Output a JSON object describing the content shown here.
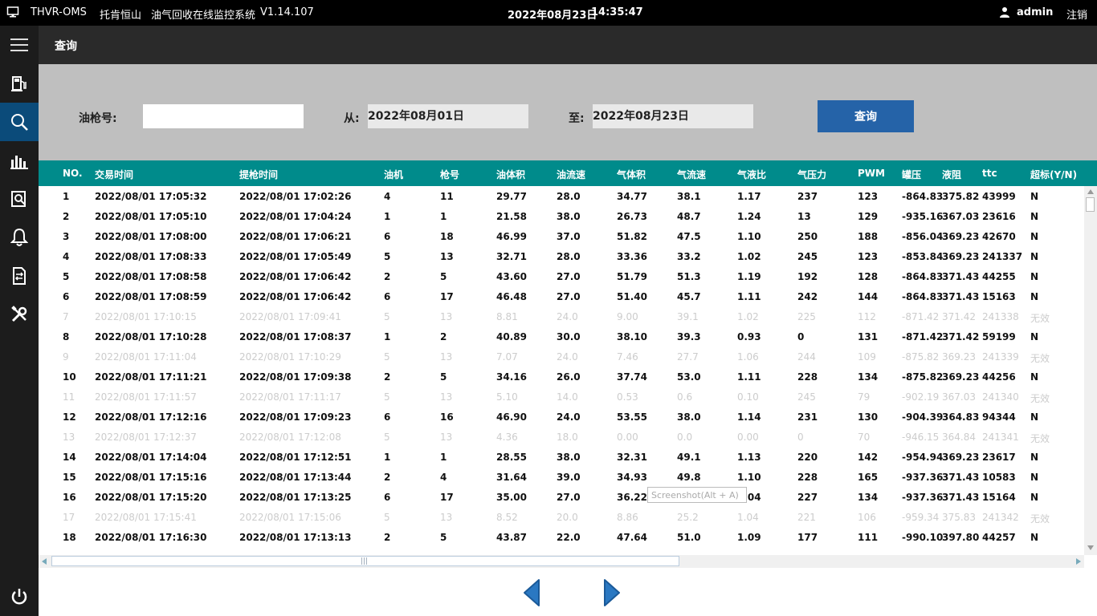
{
  "topbar": {
    "app_name": "THVR-OMS",
    "site": "托肯恒山",
    "system_name": "油气回收在线监控系统",
    "version": "V1.14.107",
    "date": "2022年08月23日",
    "time": "14:35:47",
    "user": "admin",
    "logout": "注销"
  },
  "page": {
    "title": "查询"
  },
  "filter": {
    "gun_label": "油枪号:",
    "gun_value": "",
    "from_label": "从:",
    "from_value": "2022年08月01日",
    "to_label": "至:",
    "to_value": "2022年08月23日",
    "query_button": "查询"
  },
  "table": {
    "headers": [
      "NO.",
      "交易时间",
      "提枪时间",
      "油机",
      "枪号",
      "油体积",
      "油流速",
      "气体积",
      "气流速",
      "气液比",
      "气压力",
      "PWM",
      "罐压",
      "液阻",
      "ttc",
      "超标(Y/N)"
    ],
    "rows": [
      [
        "1",
        "2022/08/01 17:05:32",
        "2022/08/01 17:02:26",
        "4",
        "11",
        "29.77",
        "28.0",
        "34.77",
        "38.1",
        "1.17",
        "237",
        "123",
        "-864.83",
        "375.82",
        "43999",
        "N"
      ],
      [
        "2",
        "2022/08/01 17:05:10",
        "2022/08/01 17:04:24",
        "1",
        "1",
        "21.58",
        "38.0",
        "26.73",
        "48.7",
        "1.24",
        "13",
        "129",
        "-935.16",
        "367.03",
        "23616",
        "N"
      ],
      [
        "3",
        "2022/08/01 17:08:00",
        "2022/08/01 17:06:21",
        "6",
        "18",
        "46.99",
        "37.0",
        "51.82",
        "47.5",
        "1.10",
        "250",
        "188",
        "-856.04",
        "369.23",
        "42670",
        "N"
      ],
      [
        "4",
        "2022/08/01 17:08:33",
        "2022/08/01 17:05:49",
        "5",
        "13",
        "32.71",
        "28.0",
        "33.36",
        "33.2",
        "1.02",
        "245",
        "123",
        "-853.84",
        "369.23",
        "241337",
        "N"
      ],
      [
        "5",
        "2022/08/01 17:08:58",
        "2022/08/01 17:06:42",
        "2",
        "5",
        "43.60",
        "27.0",
        "51.79",
        "51.3",
        "1.19",
        "192",
        "128",
        "-864.83",
        "371.43",
        "44255",
        "N"
      ],
      [
        "6",
        "2022/08/01 17:08:59",
        "2022/08/01 17:06:42",
        "6",
        "17",
        "46.48",
        "27.0",
        "51.40",
        "45.7",
        "1.11",
        "242",
        "144",
        "-864.83",
        "371.43",
        "15163",
        "N"
      ],
      [
        "7",
        "2022/08/01 17:10:15",
        "2022/08/01 17:09:41",
        "5",
        "13",
        "8.81",
        "24.0",
        "9.00",
        "39.1",
        "1.02",
        "225",
        "112",
        "-871.42",
        "371.42",
        "241338",
        "无效"
      ],
      [
        "8",
        "2022/08/01 17:10:28",
        "2022/08/01 17:08:37",
        "1",
        "2",
        "40.89",
        "30.0",
        "38.10",
        "39.3",
        "0.93",
        "0",
        "131",
        "-871.42",
        "371.42",
        "59199",
        "N"
      ],
      [
        "9",
        "2022/08/01 17:11:04",
        "2022/08/01 17:10:29",
        "5",
        "13",
        "7.07",
        "24.0",
        "7.46",
        "27.7",
        "1.06",
        "244",
        "109",
        "-875.82",
        "369.23",
        "241339",
        "无效"
      ],
      [
        "10",
        "2022/08/01 17:11:21",
        "2022/08/01 17:09:38",
        "2",
        "5",
        "34.16",
        "26.0",
        "37.74",
        "53.0",
        "1.11",
        "228",
        "134",
        "-875.82",
        "369.23",
        "44256",
        "N"
      ],
      [
        "11",
        "2022/08/01 17:11:57",
        "2022/08/01 17:11:17",
        "5",
        "13",
        "5.10",
        "14.0",
        "0.53",
        "0.6",
        "0.10",
        "245",
        "79",
        "-902.19",
        "367.03",
        "241340",
        "无效"
      ],
      [
        "12",
        "2022/08/01 17:12:16",
        "2022/08/01 17:09:23",
        "6",
        "16",
        "46.90",
        "24.0",
        "53.55",
        "38.0",
        "1.14",
        "231",
        "130",
        "-904.39",
        "364.83",
        "94344",
        "N"
      ],
      [
        "13",
        "2022/08/01 17:12:37",
        "2022/08/01 17:12:08",
        "5",
        "13",
        "4.36",
        "18.0",
        "0.00",
        "0.0",
        "0.00",
        "0",
        "70",
        "-946.15",
        "364.84",
        "241341",
        "无效"
      ],
      [
        "14",
        "2022/08/01 17:14:04",
        "2022/08/01 17:12:51",
        "1",
        "1",
        "28.55",
        "38.0",
        "32.31",
        "49.1",
        "1.13",
        "220",
        "142",
        "-954.94",
        "369.23",
        "23617",
        "N"
      ],
      [
        "15",
        "2022/08/01 17:15:16",
        "2022/08/01 17:13:44",
        "2",
        "4",
        "31.64",
        "39.0",
        "34.93",
        "49.8",
        "1.10",
        "228",
        "165",
        "-937.36",
        "371.43",
        "10583",
        "N"
      ],
      [
        "16",
        "2022/08/01 17:15:20",
        "2022/08/01 17:13:25",
        "6",
        "17",
        "35.00",
        "27.0",
        "36.22",
        "46.1",
        "1.04",
        "227",
        "134",
        "-937.36",
        "371.43",
        "15164",
        "N"
      ],
      [
        "17",
        "2022/08/01 17:15:41",
        "2022/08/01 17:15:06",
        "5",
        "13",
        "8.52",
        "20.0",
        "8.86",
        "25.2",
        "1.04",
        "221",
        "106",
        "-959.34",
        "375.83",
        "241342",
        "无效"
      ],
      [
        "18",
        "2022/08/01 17:16:30",
        "2022/08/01 17:13:13",
        "2",
        "5",
        "43.87",
        "22.0",
        "47.64",
        "51.0",
        "1.09",
        "177",
        "111",
        "-990.10",
        "397.80",
        "44257",
        "N"
      ]
    ]
  },
  "tooltip": "Screenshot(Alt + A)",
  "colors": {
    "header_teal": "#008b8b",
    "query_blue": "#2563a8",
    "nav_arrow": "#2a78c2",
    "invalid_text": "#cccccc"
  },
  "icons": {
    "menu": "hamburger-icon",
    "nav": [
      "fuel-pump-icon",
      "search-icon",
      "bar-chart-icon",
      "document-search-icon",
      "bell-icon",
      "document-transfer-icon",
      "tools-icon"
    ],
    "power": "power-icon",
    "user": "user-icon",
    "pager": [
      "previous-arrow-icon",
      "next-arrow-icon"
    ]
  }
}
